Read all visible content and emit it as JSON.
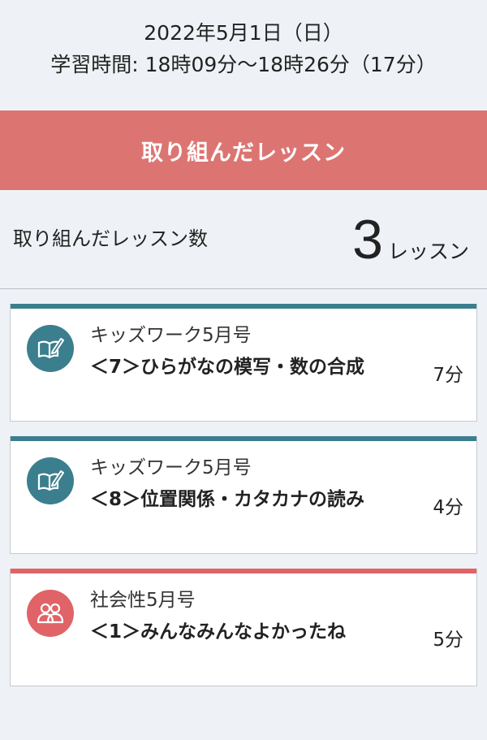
{
  "header": {
    "date": "2022年5月1日（日）",
    "study_time": "学習時間: 18時09分〜18時26分（17分）"
  },
  "banner": {
    "title": "取り組んだレッスン"
  },
  "summary": {
    "label": "取り組んだレッスン数",
    "count": "3",
    "unit": "レッスン"
  },
  "lessons": [
    {
      "category": "キッズワーク5月号",
      "title": "＜7＞ひらがなの模写・数の合成",
      "duration": "7分",
      "icon": "book-pencil-icon",
      "accent_color": "#3b7f8e"
    },
    {
      "category": "キッズワーク5月号",
      "title": "＜8＞位置関係・カタカナの読み",
      "duration": "4分",
      "icon": "book-pencil-icon",
      "accent_color": "#3b7f8e"
    },
    {
      "category": "社会性5月号",
      "title": "＜1＞みんなみんなよかったね",
      "duration": "5分",
      "icon": "people-icon",
      "accent_color": "#e06367"
    }
  ]
}
